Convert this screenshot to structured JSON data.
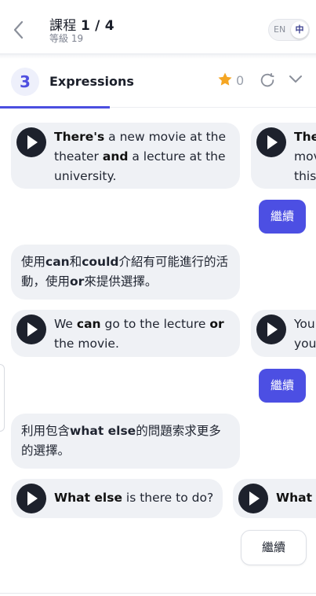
{
  "header": {
    "lesson_label": "課程",
    "lesson_num": "1 / 4",
    "level": "等級 19",
    "lang_en": "EN",
    "lang_zh": "中"
  },
  "section": {
    "number": "3",
    "title": "Expressions",
    "stars": "0"
  },
  "messages": {
    "m1_parts": [
      "There's",
      " a new movie at the theater ",
      "and",
      " a lecture at the university."
    ],
    "m1_peek": [
      "The",
      "mov",
      "this"
    ],
    "explain1": [
      "使用",
      "can",
      "和",
      "could",
      "介紹有可能進行的活動，使用",
      "or",
      "來提供選擇。"
    ],
    "m2_parts": [
      "We ",
      "can",
      " go to the lecture ",
      "or",
      " the movie."
    ],
    "m2_peek": [
      "You",
      "you"
    ],
    "explain2": [
      "利用包含",
      "what else",
      "的問題索求更多的選擇。"
    ],
    "m3_parts": [
      "What else",
      " is there to do?"
    ],
    "m3_peek": "What e"
  },
  "buttons": {
    "continue": "繼續"
  },
  "colors": {
    "accent": "#4c4fe3",
    "star": "#f5a623",
    "bubble": "#eff1f5"
  }
}
